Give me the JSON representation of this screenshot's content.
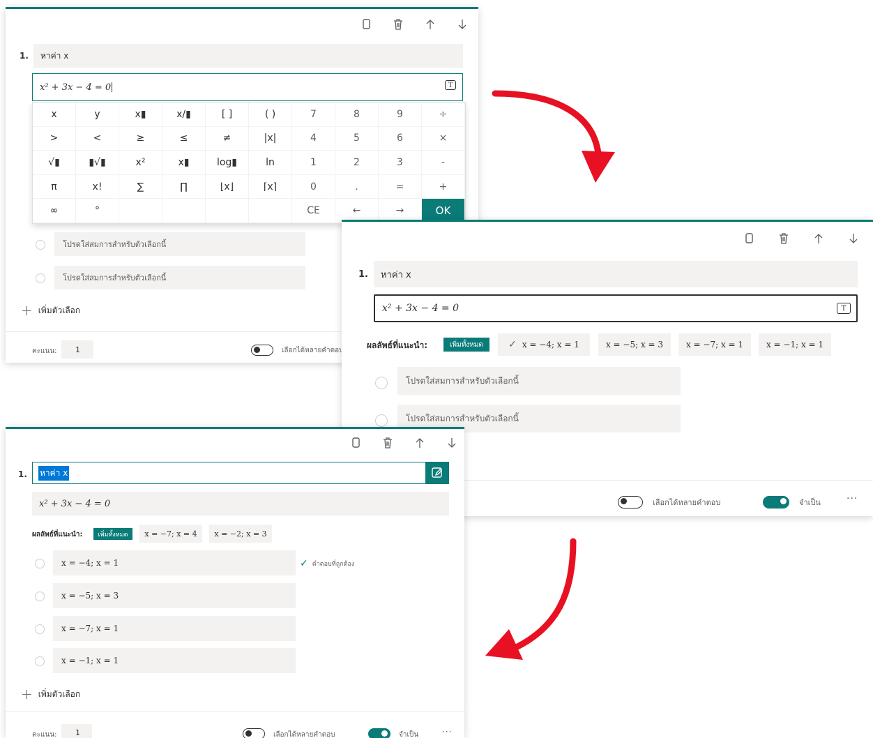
{
  "colors": {
    "accent": "#0b7b78",
    "arrow": "#e81123"
  },
  "toolbar": {
    "copy_icon": "copy-icon",
    "delete_icon": "trash-icon",
    "up_icon": "arrow-up-icon",
    "down_icon": "arrow-down-icon"
  },
  "panel1": {
    "question_number": "1.",
    "question_title": "หาค่า x",
    "equation": "x² + 3x − 4 = 0",
    "keypad_keys": [
      "x",
      "y",
      "x▮",
      "x/▮",
      "[ ]",
      "( )",
      "7",
      "8",
      "9",
      "÷",
      ">",
      "<",
      "≥",
      "≤",
      "≠",
      "|x|",
      "4",
      "5",
      "6",
      "×",
      "√▮",
      "▮√▮",
      "x²",
      "x▮",
      "log▮",
      "ln",
      "1",
      "2",
      "3",
      "-",
      "π",
      "x!",
      "∑",
      "∏",
      "⌊x⌋",
      "⌈x⌉",
      "0",
      ".",
      "=",
      "+",
      "∞",
      "°",
      "",
      "",
      "",
      "",
      "CE",
      "←",
      "→",
      "OK"
    ],
    "option_placeholders": [
      "โปรดใส่สมการสำหรับตัวเลือกนี้",
      "โปรดใส่สมการสำหรับตัวเลือกนี้"
    ],
    "add_option": "เพิ่มตัวเลือก",
    "score_label": "คะแนน:",
    "score_value": "1",
    "multiple_answers": "เลือกได้หลายคำตอบ"
  },
  "panel2": {
    "question_number": "1.",
    "question_title": "หาค่า x",
    "equation": "x² + 3x − 4 = 0",
    "suggested_label": "ผลลัพธ์ที่แนะนำ:",
    "add_all": "เพิ่มทั้งหมด",
    "suggestions": [
      "x = −4; x = 1",
      "x = −5; x = 3",
      "x = −7; x = 1",
      "x = −1; x = 1"
    ],
    "option_placeholders": [
      "โปรดใส่สมการสำหรับตัวเลือกนี้",
      "โปรดใส่สมการสำหรับตัวเลือกนี้"
    ],
    "multiple_answers": "เลือกได้หลายคำตอบ",
    "required": "จำเป็น",
    "more": "···"
  },
  "panel3": {
    "question_number": "1.",
    "question_title": "หาค่า x",
    "equation": "x² + 3x − 4 = 0",
    "suggested_label": "ผลลัพธ์ที่แนะนำ:",
    "add_all": "เพิ่มทั้งหมด",
    "suggestions": [
      "x = −7; x = 4",
      "x = −2; x = 3"
    ],
    "options": [
      "x = −4; x = 1",
      "x = −5; x = 3",
      "x = −7; x = 1",
      "x = −1; x = 1"
    ],
    "correct_answer": "คำตอบที่ถูกต้อง",
    "add_option": "เพิ่มตัวเลือก",
    "score_label": "คะแนน:",
    "score_value": "1",
    "multiple_answers": "เลือกได้หลายคำตอบ",
    "required": "จำเป็น",
    "more": "···"
  }
}
